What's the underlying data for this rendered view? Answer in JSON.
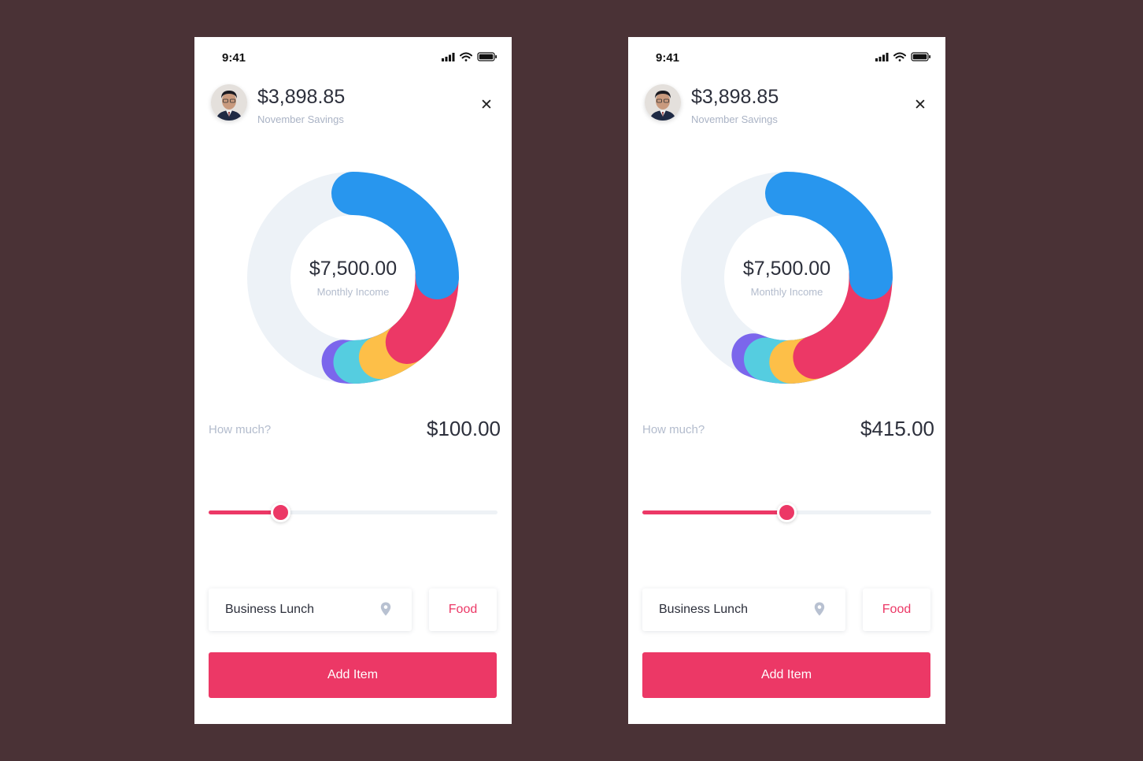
{
  "screens": [
    {
      "status": {
        "time": "9:41"
      },
      "header": {
        "savings_amount": "$3,898.85",
        "savings_label": "November Savings",
        "close_icon": "close-icon"
      },
      "donut": {
        "center_amount": "$7,500.00",
        "center_label": "Monthly Income"
      },
      "amount": {
        "label": "How much?",
        "value": "$100.00"
      },
      "slider": {
        "fraction": 0.25
      },
      "fields": {
        "description": "Business Lunch",
        "location_icon": "map-pin-icon",
        "category": "Food"
      },
      "action": {
        "label": "Add Item"
      }
    },
    {
      "status": {
        "time": "9:41"
      },
      "header": {
        "savings_amount": "$3,898.85",
        "savings_label": "November Savings",
        "close_icon": "close-icon"
      },
      "donut": {
        "center_amount": "$7,500.00",
        "center_label": "Monthly Income"
      },
      "amount": {
        "label": "How much?",
        "value": "$415.00"
      },
      "slider": {
        "fraction": 0.5
      },
      "fields": {
        "description": "Business Lunch",
        "location_icon": "map-pin-icon",
        "category": "Food"
      },
      "action": {
        "label": "Add Item"
      }
    }
  ],
  "colors": {
    "background": "#4a3236",
    "accent": "#ec3866",
    "blue": "#2896ee",
    "yellow": "#fdbf48",
    "cyan": "#55cde0",
    "purple": "#7b66ec",
    "track": "#edf2f7"
  }
}
